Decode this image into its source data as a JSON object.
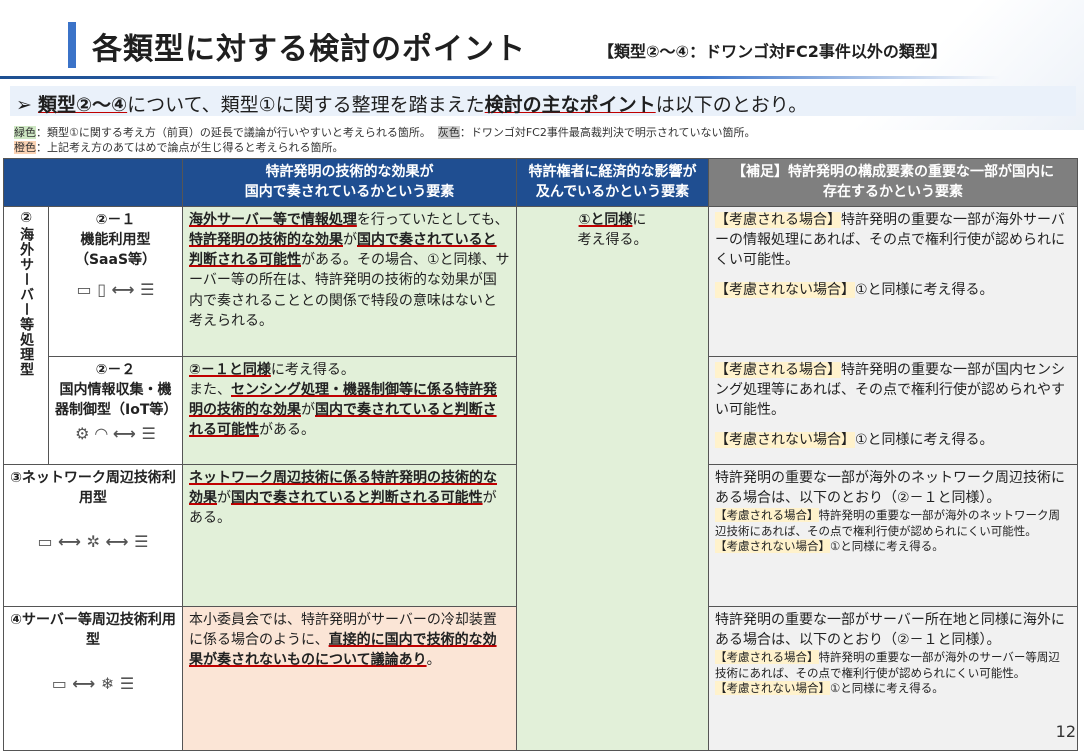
{
  "header": {
    "title": "各類型に対する検討のポイント",
    "subtitle": "【類型②～④：ドワンゴ対FC2事件以外の類型】"
  },
  "lead": {
    "bullet": "➢",
    "t1": "類型②～④",
    "t2": "について、類型①に関する整理を踏まえた",
    "t3": "検討の主なポイント",
    "t4": "は以下のとおり。"
  },
  "legend": {
    "green_tag": "緑色",
    "green_text": "：類型①に関する考え方（前頁）の延長で議論が行いやすいと考えられる箇所。",
    "gray_tag": "灰色",
    "gray_text": "：ドワンゴ対FC2事件最高裁判決で明示されていない箇所。",
    "orange_tag": "橙色",
    "orange_text": "：上記考え方のあてはめで論点が生じ得ると考えられる箇所。"
  },
  "table": {
    "headers": {
      "tech_effect": "特許発明の技術的な効果が\n国内で奏されているかという要素",
      "economic": "特許権者に経済的な影響が\n及んでいるかという要素",
      "supplement": "【補足】特許発明の構成要素の重要な一部が国内に\n存在するかという要素"
    },
    "group2_label": "②海外サーバー等処理型",
    "row21": {
      "cat": "②－１\n機能利用型\n（SaaS等）",
      "icons": "▭ ▯ ⟷ ☰",
      "t_a": "海外サーバー等で情報処理",
      "t_b": "を行っていたとしても、",
      "t_c": "特許発明の技術的な効果",
      "t_d": "が",
      "t_e": "国内で奏されていると判断される可能性",
      "t_f": "がある。その場合、①と同様、サーバー等の所在は、特許発明の技術的な効果が国内で奏されることとの関係で特段の意味はないと考えられる。",
      "s_a": "【考慮される場合】",
      "s_b": "特許発明の重要な一部が海外サーバーの情報処理にあれば、その点で権利行使が認められにくい可能性。",
      "s_c": "【考慮されない場合】",
      "s_d": "①と同様に考え得る。"
    },
    "row22": {
      "cat": "②－２\n国内情報収集・機器制御型（IoT等）",
      "icons": "⚙ ◠ ⟷ ☰",
      "t_a": "②－１と同様",
      "t_b": "に考え得る。\nまた、",
      "t_c": "センシング処理・機器制御等に係る特許発明の技術的な効果",
      "t_d": "が",
      "t_e": "国内で奏されていると判断される可能性",
      "t_f": "がある。",
      "s_a": "【考慮される場合】",
      "s_b": "特許発明の重要な一部が国内センシング処理等にあれば、その点で権利行使が認められやすい可能性。",
      "s_c": "【考慮されない場合】",
      "s_d": "①と同様に考え得る。"
    },
    "row3": {
      "cat": "③ネットワーク周辺技術利用型",
      "icons": "▭ ⟷ ✲ ⟷ ☰",
      "t_a": "ネットワーク周辺技術に係る特許発明の技術的な効果",
      "t_b": "が",
      "t_c": "国内で奏されていると判断される可能性",
      "t_d": "がある。",
      "s_main": "特許発明の重要な一部が海外のネットワーク周辺技術にある場合は、以下のとおり（②－１と同様）。",
      "s_a": "【考慮される場合】",
      "s_b": "特許発明の重要な一部が海外のネットワーク周辺技術にあれば、その点で権利行使が認められにくい可能性。",
      "s_c": "【考慮されない場合】",
      "s_d": "①と同様に考え得る。"
    },
    "row4": {
      "cat": "④サーバー等周辺技術利用型",
      "icons": "▭ ⟷ ❄ ☰",
      "t_a": "本小委員会では、特許発明がサーバーの冷却装置に係る場合のように、",
      "t_b": "直接的に国内で技術的な効果が奏されないものについて議論あり",
      "t_c": "。",
      "s_main": "特許発明の重要な一部がサーバー所在地と同様に海外にある場合は、以下のとおり（②－１と同様）。",
      "s_a": "【考慮される場合】",
      "s_b": "特許発明の重要な一部が海外のサーバー等周辺技術にあれば、その点で権利行使が認められにくい可能性。",
      "s_c": "【考慮されない場合】",
      "s_d": "①と同様に考え得る。"
    },
    "economic": {
      "t_a": "①と同様",
      "t_b": "に",
      "t_c": "考え得る。"
    }
  },
  "page_number": "12"
}
